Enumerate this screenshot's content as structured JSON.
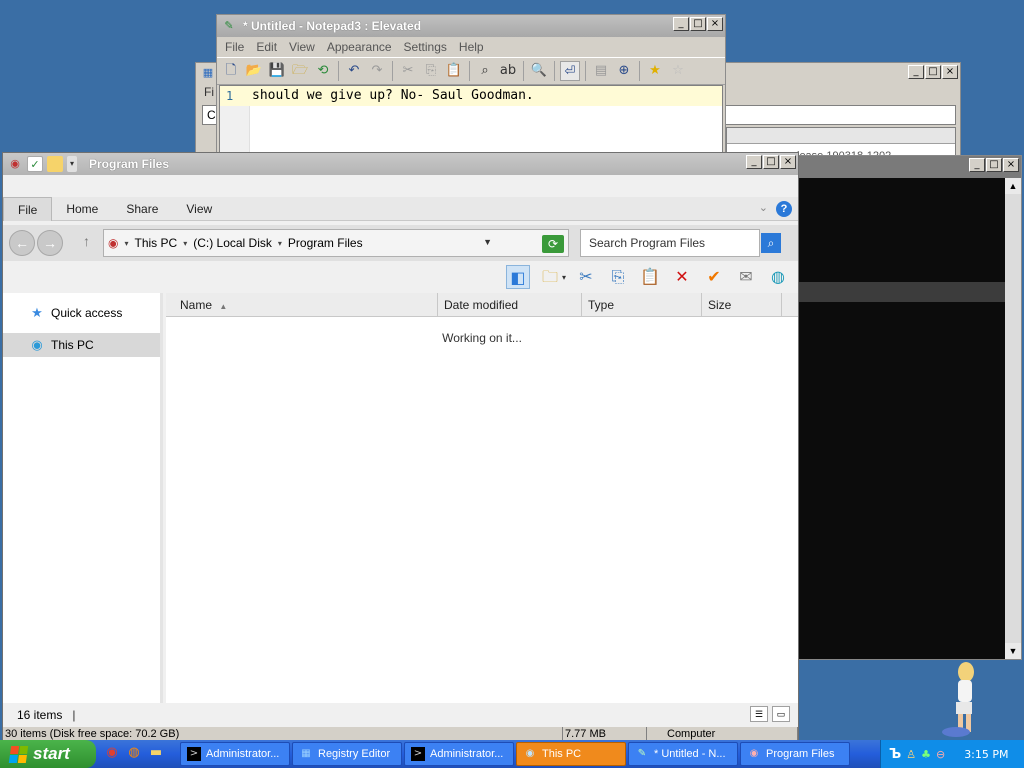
{
  "notepad": {
    "title": "* Untitled - Notepad3 : Elevated",
    "menu": [
      "File",
      "Edit",
      "View",
      "Appearance",
      "Settings",
      "Help"
    ],
    "line_number": "1",
    "line_text": "should we give up? No- Saul Goodman."
  },
  "regedit": {
    "menu_stub": "Fi",
    "address_stub": "Co",
    "background_text": "lease.190318-1202"
  },
  "explorer": {
    "title": "Program Files",
    "tabs": [
      "File",
      "Home",
      "Share",
      "View"
    ],
    "help_label": "?",
    "breadcrumb": [
      "This PC",
      "(C:) Local Disk",
      "Program Files"
    ],
    "search_placeholder": "Search Program Files",
    "nav": {
      "quick_access": "Quick access",
      "this_pc": "This PC"
    },
    "columns": [
      "Name",
      "Date modified",
      "Type",
      "Size"
    ],
    "loading_text": "Working on it...",
    "status_items": "16 items",
    "status_cursor": "|",
    "status2": [
      "30 items (Disk free space: 70.2 GB)",
      "7.77 MB",
      "Computer"
    ]
  },
  "taskbar": {
    "start_label": "start",
    "tasks": [
      {
        "label": "Administrator...",
        "icon": "cmd-icon"
      },
      {
        "label": "Registry Editor",
        "icon": "regedit-icon"
      },
      {
        "label": "Administrator...",
        "icon": "cmd-icon"
      },
      {
        "label": "This PC",
        "icon": "this-pc-icon"
      },
      {
        "label": "* Untitled - N...",
        "icon": "notepad-icon"
      },
      {
        "label": "Program Files",
        "icon": "explorer-icon"
      }
    ],
    "clock": "3:15 PM"
  },
  "colors": {
    "desktop": "#3a6ea5",
    "taskbar": "#245edb",
    "start": "#2f8f2f",
    "active_task": "#f08a1c",
    "tray": "#0f8de8"
  }
}
